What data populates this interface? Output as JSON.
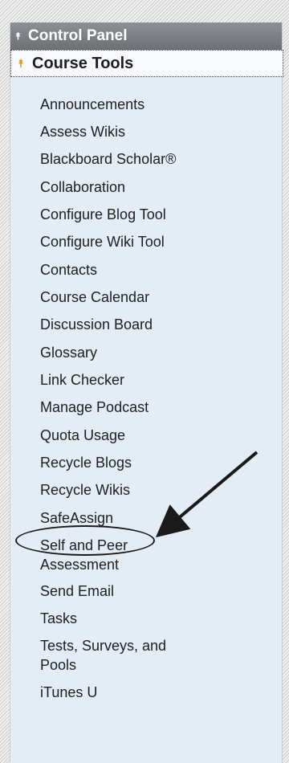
{
  "control_panel": {
    "title": "Control Panel",
    "collapse_icon": "double-chevron-up-icon"
  },
  "course_tools": {
    "title": "Course Tools",
    "collapse_icon": "double-chevron-up-icon",
    "chevron_color": "#d09a2a",
    "items": [
      {
        "label": "Announcements"
      },
      {
        "label": "Assess Wikis"
      },
      {
        "label": "Blackboard Scholar®"
      },
      {
        "label": "Collaboration"
      },
      {
        "label": "Configure Blog Tool"
      },
      {
        "label": "Configure Wiki Tool"
      },
      {
        "label": "Contacts"
      },
      {
        "label": "Course Calendar"
      },
      {
        "label": "Discussion Board"
      },
      {
        "label": "Glossary"
      },
      {
        "label": "Link Checker"
      },
      {
        "label": "Manage Podcast"
      },
      {
        "label": "Quota Usage"
      },
      {
        "label": "Recycle Blogs"
      },
      {
        "label": "Recycle Wikis"
      },
      {
        "label": "SafeAssign",
        "highlighted": true
      },
      {
        "label": "Self and Peer Assessment"
      },
      {
        "label": "Send Email"
      },
      {
        "label": "Tasks"
      },
      {
        "label": "Tests, Surveys, and Pools"
      },
      {
        "label": "iTunes U"
      }
    ]
  },
  "annotation": {
    "type": "arrow-and-ellipse",
    "target": "SafeAssign"
  }
}
